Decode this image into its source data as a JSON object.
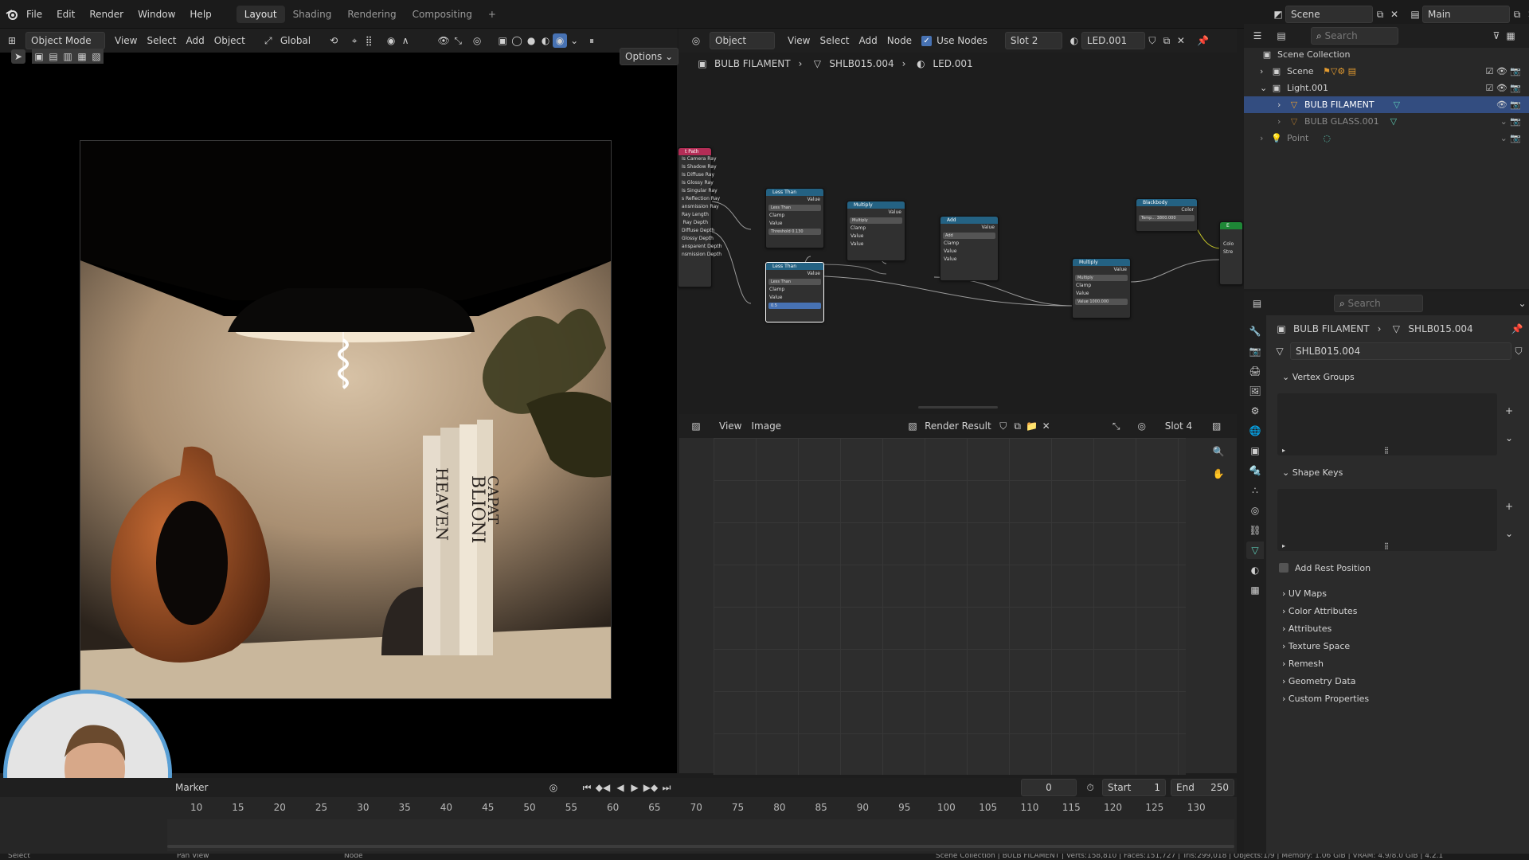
{
  "menu": [
    "File",
    "Edit",
    "Render",
    "Window",
    "Help"
  ],
  "workspaces": [
    {
      "label": "Layout",
      "active": true
    },
    {
      "label": "Shading",
      "active": false
    },
    {
      "label": "Rendering",
      "active": false
    },
    {
      "label": "Compositing",
      "active": false
    }
  ],
  "top_right": {
    "scene": "Scene",
    "view_layer": "Main"
  },
  "viewport": {
    "mode": "Object Mode",
    "menus": [
      "View",
      "Select",
      "Add",
      "Object"
    ],
    "transform": "Global",
    "options": "Options",
    "book_spine_1": "HEAVEN",
    "book_spine_2": "BLIONI",
    "book_spine_3": "CAPAT"
  },
  "node_editor": {
    "type": "Object",
    "menus": [
      "View",
      "Select",
      "Add",
      "Node"
    ],
    "use_nodes_label": "Use Nodes",
    "slot": "Slot 2",
    "material": "LED.001",
    "breadcrumb": [
      "BULB FILAMENT",
      "SHLB015.004",
      "LED.001"
    ],
    "light_path": {
      "title": "t Path",
      "outputs": [
        "Is Camera Ray",
        "Is Shadow Ray",
        "Is Diffuse Ray",
        "Is Glossy Ray",
        "Is Singular Ray",
        "s Reflection Ray",
        "ansmission Ray",
        "Ray Length",
        "Ray Depth",
        "Diffuse Depth",
        "Glossy Depth",
        "ansparent Depth",
        "nsmission Depth"
      ]
    },
    "less_than_1": {
      "title": "Less Than",
      "out": "Value",
      "op": "Less Than",
      "clamp": "Clamp",
      "in": "Value",
      "threshold": "Threshold  0.130"
    },
    "less_than_2": {
      "title": "Less Than",
      "out": "Value",
      "op": "Less Than",
      "clamp": "Clamp",
      "in": "Value",
      "threshold": "0.5"
    },
    "multiply_1": {
      "title": "Multiply",
      "out": "Value",
      "op": "Multiply",
      "clamp": "Clamp",
      "in1": "Value",
      "in2": "Value"
    },
    "add": {
      "title": "Add",
      "out": "Value",
      "op": "Add",
      "clamp": "Clamp",
      "in1": "Value",
      "in2": "Value"
    },
    "multiply_2": {
      "title": "Multiply",
      "out": "Value",
      "op": "Multiply",
      "clamp": "Clamp",
      "in1": "Value",
      "value": "Value  1000.000"
    },
    "blackbody": {
      "title": "Blackbody",
      "out": "Color",
      "temp": "Temp...  3800.000"
    },
    "emission": {
      "title": "E",
      "in1": "Colo",
      "in2": "Stre"
    }
  },
  "image_editor": {
    "menus": [
      "View",
      "Image"
    ],
    "image": "Render Result",
    "slot": "Slot 4"
  },
  "outliner": {
    "search_placeholder": "Search",
    "rows": [
      {
        "label": "Scene Collection",
        "indent": 0
      },
      {
        "label": "Scene",
        "indent": 1
      },
      {
        "label": "Light.001",
        "indent": 1
      },
      {
        "label": "BULB FILAMENT",
        "indent": 2,
        "selected": true
      },
      {
        "label": "BULB GLASS.001",
        "indent": 2
      },
      {
        "label": "Point",
        "indent": 1
      }
    ]
  },
  "properties": {
    "search_placeholder": "Search",
    "breadcrumb": [
      "BULB FILAMENT",
      "SHLB015.004"
    ],
    "mesh_name": "SHLB015.004",
    "sections": {
      "vertex_groups": "Vertex Groups",
      "shape_keys": "Shape Keys",
      "add_rest_position": "Add Rest Position",
      "collapsed": [
        "UV Maps",
        "Color Attributes",
        "Attributes",
        "Texture Space",
        "Remesh",
        "Geometry Data",
        "Custom Properties"
      ]
    }
  },
  "timeline": {
    "marker": "Marker",
    "current_frame": "0",
    "start_label": "Start",
    "start": "1",
    "end_label": "End",
    "end": "250",
    "ticks": [
      "10",
      "15",
      "20",
      "25",
      "30",
      "35",
      "40",
      "45",
      "50",
      "55",
      "60",
      "65",
      "70",
      "75",
      "80",
      "85",
      "90",
      "95",
      "100",
      "105",
      "110",
      "115",
      "120",
      "125",
      "130"
    ]
  },
  "status_bar": {
    "left": [
      "Select",
      "Pan View",
      "Node"
    ],
    "right": "Scene Collection | BULB FILAMENT | Verts:158,810 | Faces:151,727 | Tris:299,018 | Objects:1/9 | Memory: 1.06 GiB | VRAM: 4.9/8.0 GiB | 4.2.1"
  }
}
